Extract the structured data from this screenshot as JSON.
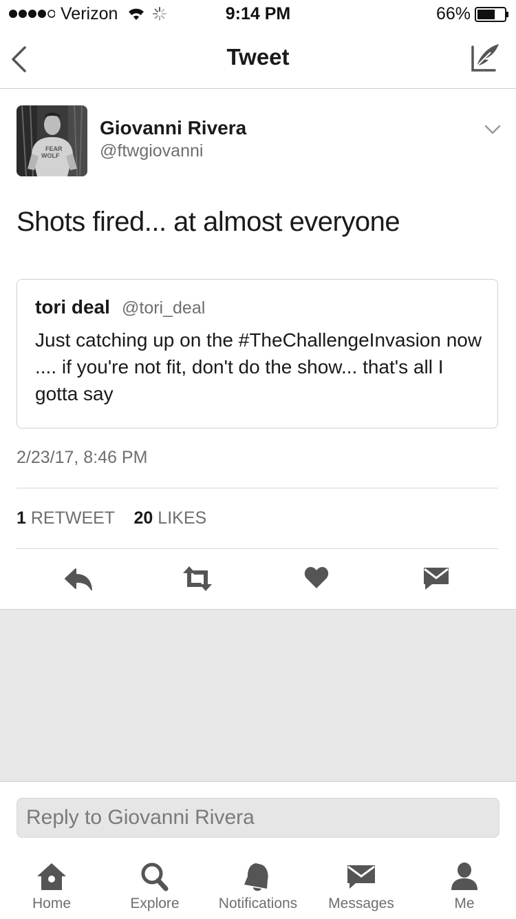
{
  "status_bar": {
    "carrier": "Verizon",
    "time": "9:14 PM",
    "battery": "66%",
    "battery_level": 0.66
  },
  "nav": {
    "title": "Tweet"
  },
  "tweet": {
    "author_name": "Giovanni Rivera",
    "author_handle": "@ftwgiovanni",
    "text": "Shots fired... at almost everyone",
    "quoted": {
      "author_name": "tori deal",
      "author_handle": "@tori_deal",
      "text": "Just catching up on the #TheChallengeInvasion now .... if you're not fit, don't do the show... that's all I gotta say"
    },
    "timestamp": "2/23/17, 8:46 PM",
    "retweet_count": "1",
    "retweet_label": "RETWEET",
    "like_count": "20",
    "like_label": "LIKES"
  },
  "reply": {
    "placeholder": "Reply to Giovanni Rivera"
  },
  "tab_bar": {
    "items": [
      {
        "label": "Home",
        "icon": "home-icon"
      },
      {
        "label": "Explore",
        "icon": "search-icon"
      },
      {
        "label": "Notifications",
        "icon": "bell-icon"
      },
      {
        "label": "Messages",
        "icon": "envelope-icon"
      },
      {
        "label": "Me",
        "icon": "person-icon"
      }
    ]
  },
  "colors": {
    "text": "#1a1a1a",
    "secondary_text": "#6e6e6e",
    "icon": "#555555",
    "gray_area": "#e8e8e8"
  }
}
